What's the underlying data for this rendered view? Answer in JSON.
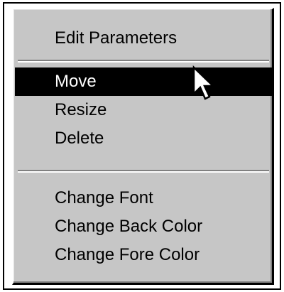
{
  "context_menu": {
    "groups": [
      {
        "items": [
          {
            "label": "Edit Parameters",
            "selected": false
          }
        ]
      },
      {
        "items": [
          {
            "label": "Move",
            "selected": true
          },
          {
            "label": "Resize",
            "selected": false
          },
          {
            "label": "Delete",
            "selected": false
          }
        ]
      },
      {
        "items": [
          {
            "label": "Change Font",
            "selected": false
          },
          {
            "label": "Change Back Color",
            "selected": false
          },
          {
            "label": "Change Fore Color",
            "selected": false
          }
        ]
      }
    ]
  },
  "colors": {
    "menu_background": "#c6c6c6",
    "highlight_background": "#000000",
    "highlight_text": "#ffffff",
    "text": "#000000"
  },
  "icons": {
    "cursor": "arrow-cursor-icon"
  }
}
